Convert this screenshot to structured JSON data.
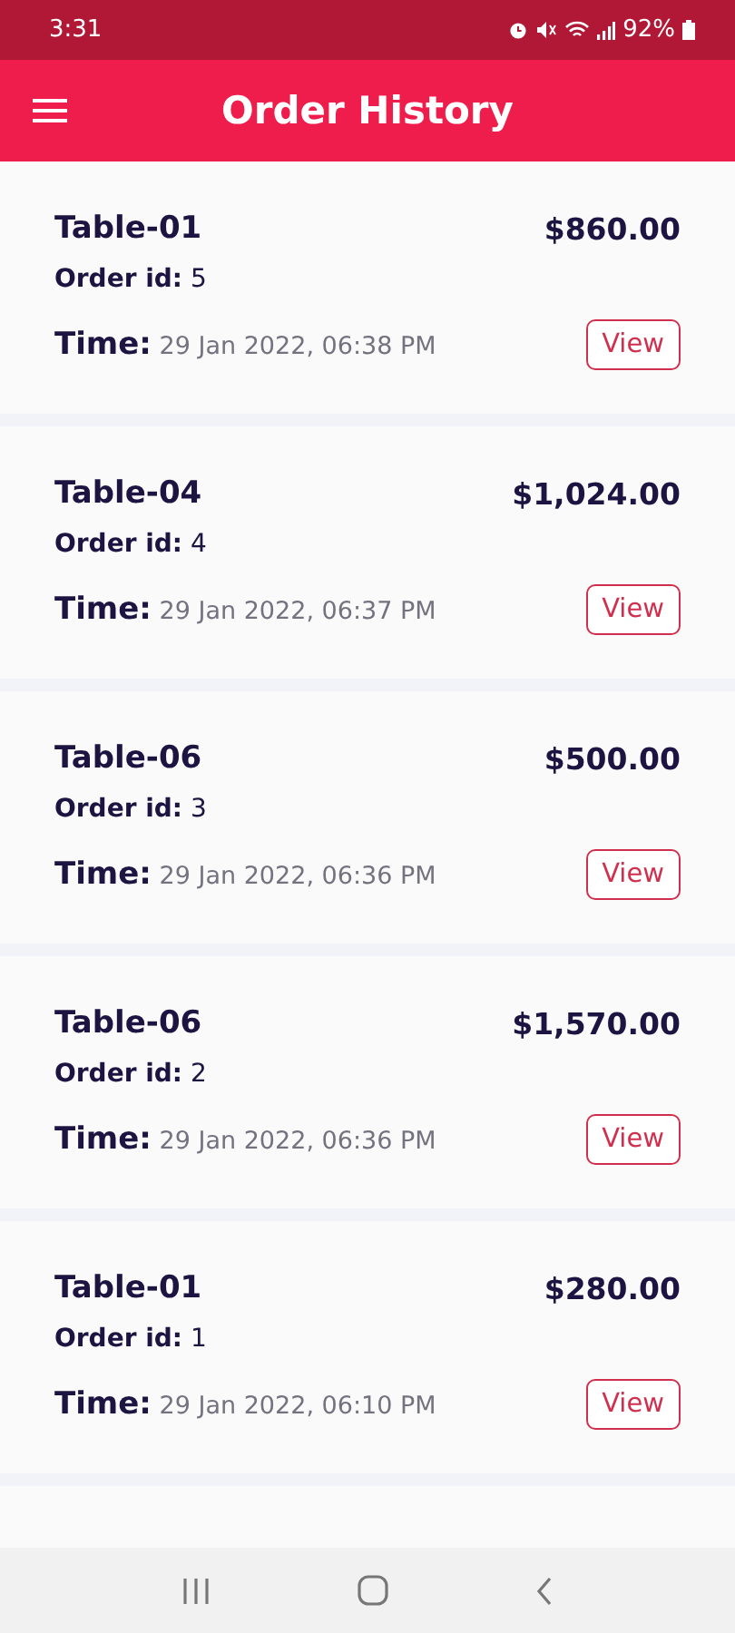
{
  "status_bar": {
    "time": "3:31",
    "battery": "92%"
  },
  "app_bar": {
    "title": "Order History"
  },
  "orders": [
    {
      "table": "Table-01",
      "amount": "$860.00",
      "order_id_label": "Order id:",
      "order_id": "5",
      "time_label": "Time:",
      "time": "29 Jan 2022, 06:38 PM",
      "button": "View"
    },
    {
      "table": "Table-04",
      "amount": "$1,024.00",
      "order_id_label": "Order id:",
      "order_id": "4",
      "time_label": "Time:",
      "time": "29 Jan 2022, 06:37 PM",
      "button": "View"
    },
    {
      "table": "Table-06",
      "amount": "$500.00",
      "order_id_label": "Order id:",
      "order_id": "3",
      "time_label": "Time:",
      "time": "29 Jan 2022, 06:36 PM",
      "button": "View"
    },
    {
      "table": "Table-06",
      "amount": "$1,570.00",
      "order_id_label": "Order id:",
      "order_id": "2",
      "time_label": "Time:",
      "time": "29 Jan 2022, 06:36 PM",
      "button": "View"
    },
    {
      "table": "Table-01",
      "amount": "$280.00",
      "order_id_label": "Order id:",
      "order_id": "1",
      "time_label": "Time:",
      "time": "29 Jan 2022, 06:10 PM",
      "button": "View"
    }
  ]
}
